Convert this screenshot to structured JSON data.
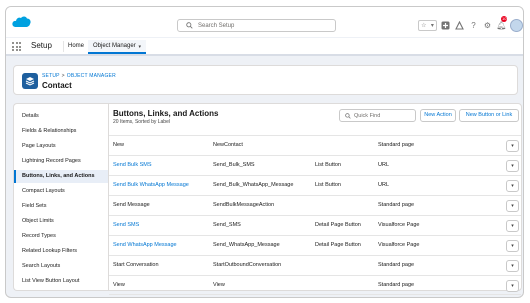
{
  "header": {
    "search_placeholder": "Search Setup",
    "notification_count": "10"
  },
  "app_nav": {
    "app_name": "Setup",
    "tabs": [
      {
        "label": "Home"
      },
      {
        "label": "Object Manager"
      }
    ]
  },
  "object_header": {
    "breadcrumb_root": "SETUP",
    "breadcrumb_sep": ">",
    "breadcrumb_current": "OBJECT MANAGER",
    "title": "Contact"
  },
  "sidebar": {
    "items": [
      {
        "label": "Details"
      },
      {
        "label": "Fields & Relationships"
      },
      {
        "label": "Page Layouts"
      },
      {
        "label": "Lightning Record Pages"
      },
      {
        "label": "Buttons, Links, and Actions",
        "active": true
      },
      {
        "label": "Compact Layouts"
      },
      {
        "label": "Field Sets"
      },
      {
        "label": "Object Limits"
      },
      {
        "label": "Record Types"
      },
      {
        "label": "Related Lookup Filters"
      },
      {
        "label": "Search Layouts"
      },
      {
        "label": "List View Button Layout"
      }
    ]
  },
  "main": {
    "title": "Buttons, Links, and Actions",
    "subtitle": "20 Items, Sorted by Label",
    "quick_find_placeholder": "Quick Find",
    "new_action_label": "New Action",
    "new_button_label": "New Button or Link",
    "rows": [
      {
        "label": "New",
        "name": "NewContact",
        "type": "",
        "content": "Standard page",
        "link": false
      },
      {
        "label": "Send Bulk SMS",
        "name": "Send_Bulk_SMS",
        "type": "List Button",
        "content": "URL",
        "link": true
      },
      {
        "label": "Send Bulk WhatsApp Message",
        "name": "Send_Bulk_WhatsApp_Message",
        "type": "List Button",
        "content": "URL",
        "link": true
      },
      {
        "label": "Send Message",
        "name": "SendBulkMessageAction",
        "type": "",
        "content": "Standard page",
        "link": false
      },
      {
        "label": "Send SMS",
        "name": "Send_SMS",
        "type": "Detail Page Button",
        "content": "Visualforce Page",
        "link": true
      },
      {
        "label": "Send WhatsApp Message",
        "name": "Send_WhatsApp_Message",
        "type": "Detail Page Button",
        "content": "Visualforce Page",
        "link": true
      },
      {
        "label": "Start Conversation",
        "name": "StartOutboundConversation",
        "type": "",
        "content": "Standard page",
        "link": false
      },
      {
        "label": "View",
        "name": "View",
        "type": "",
        "content": "Standard page",
        "link": false
      }
    ]
  },
  "colors": {
    "brand": "#0176d3",
    "logo": "#00a1e0",
    "object_icon": "#1e5f9e",
    "badge": "#ea001e"
  },
  "icons": [
    "salesforce-cloud-logo",
    "search-icon",
    "star-icon",
    "add-icon",
    "trailhead-icon",
    "help-icon",
    "gear-icon",
    "bell-icon",
    "app-launcher-icon",
    "chevron-down-icon",
    "layers-icon"
  ]
}
